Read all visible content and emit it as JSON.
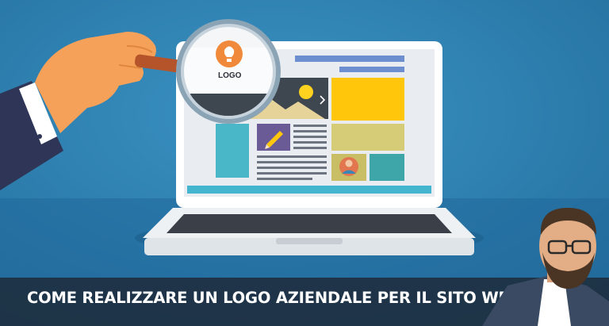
{
  "banner": {
    "title": "COME REALIZZARE UN LOGO AZIENDALE PER IL SITO WEB"
  },
  "illustration": {
    "logo_text": "LOGO"
  },
  "colors": {
    "background": "#2b7fb0",
    "background_floor": "#246f9c",
    "screen_yellow": "#ffc60b",
    "screen_khaki": "#d6cc78",
    "screen_teal": "#4ab7c9",
    "screen_purple": "#6a5a96",
    "laptop_base": "#eef1f4",
    "caption_band": "#1e2430",
    "logo_orange": "#f08a3a"
  },
  "icons": [
    "hand-icon",
    "magnifier-icon",
    "lightbulb-icon",
    "pencil-icon",
    "sun-icon",
    "avatar-icon"
  ]
}
